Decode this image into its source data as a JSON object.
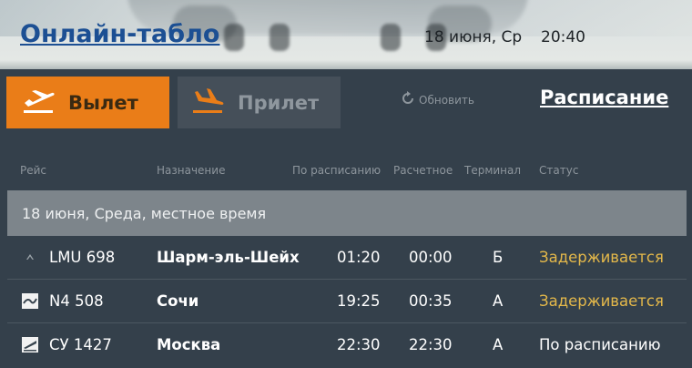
{
  "header": {
    "title": "Онлайн-табло",
    "date": "18 июня, Ср",
    "time": "20:40"
  },
  "tabs": {
    "departure": "Вылет",
    "arrival": "Прилет",
    "refresh": "Обновить",
    "schedule": "Расписание"
  },
  "columns": {
    "flight": "Рейс",
    "destination": "Назначение",
    "scheduled": "По расписанию",
    "estimated": "Расчетное",
    "terminal": "Терминал",
    "status": "Статус"
  },
  "section_label": "18 июня, Среда, местное время",
  "flights": [
    {
      "flight": "LMU 698",
      "destination": "Шарм-эль-Шейх",
      "scheduled": "01:20",
      "estimated": "00:00",
      "terminal": "Б",
      "status": "Задерживается",
      "airline_icon": "airline-logo-icon"
    },
    {
      "flight": "N4 508",
      "destination": "Сочи",
      "scheduled": "19:25",
      "estimated": "00:35",
      "terminal": "A",
      "status": "Задерживается",
      "airline_icon": "airline-logo-icon"
    },
    {
      "flight": "СУ 1427",
      "destination": "Москва",
      "scheduled": "22:30",
      "estimated": "22:30",
      "terminal": "A",
      "status": "По расписанию",
      "airline_icon": "airline-logo-icon"
    }
  ],
  "colors": {
    "accent": "#ea7d18",
    "delayed": "#e4b84a",
    "background": "#34404b"
  }
}
